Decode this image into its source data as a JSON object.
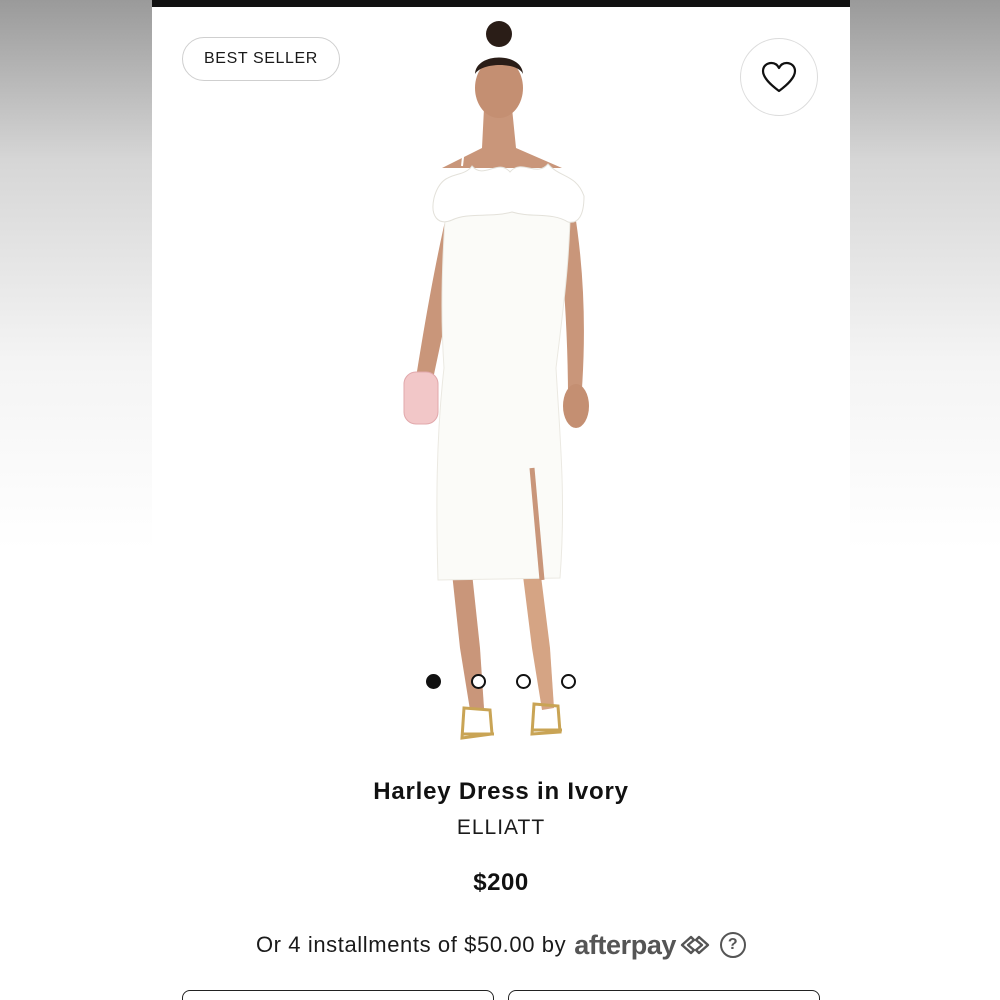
{
  "badge": {
    "label": "BEST SELLER"
  },
  "favorite": {
    "icon": "heart-icon"
  },
  "gallery": {
    "total_images": 4,
    "active_index": 0
  },
  "product": {
    "name": "Harley Dress in Ivory",
    "brand": "ELLIATT",
    "price": "$200"
  },
  "payment": {
    "text": "Or 4 installments of $50.00 by",
    "provider": "afterpay",
    "help_icon": "question-icon",
    "help_symbol": "?"
  },
  "colors": {
    "text": "#111111",
    "badge_border": "#cfcfcf",
    "afterpay_gray": "#555555"
  }
}
